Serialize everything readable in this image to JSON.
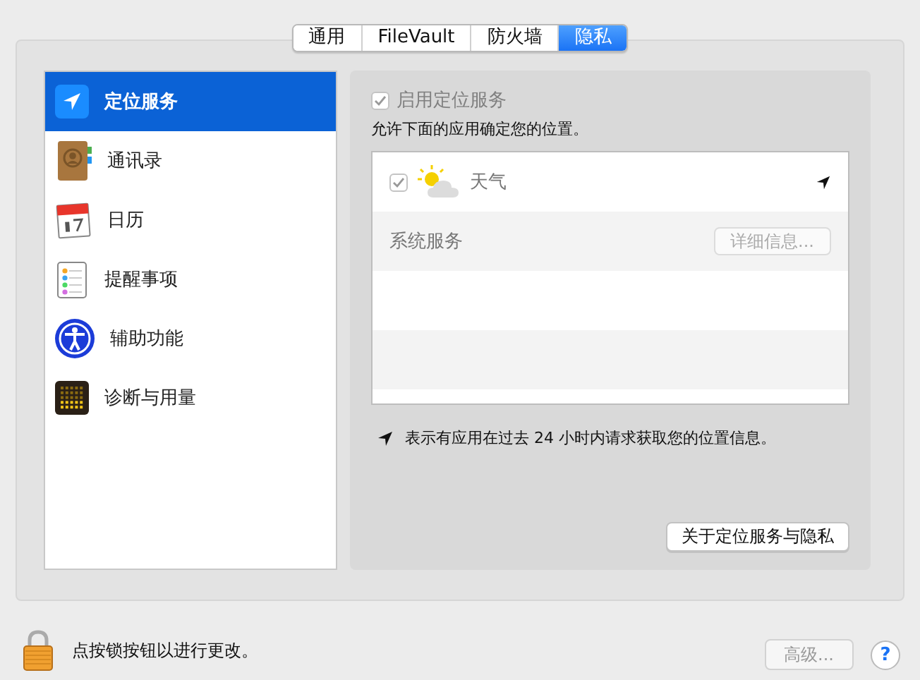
{
  "tabs": [
    {
      "label": "通用",
      "selected": false
    },
    {
      "label": "FileVault",
      "selected": false
    },
    {
      "label": "防火墙",
      "selected": false
    },
    {
      "label": "隐私",
      "selected": true
    }
  ],
  "sidebar": {
    "items": [
      {
        "label": "定位服务",
        "selected": true
      },
      {
        "label": "通讯录",
        "selected": false
      },
      {
        "label": "日历",
        "selected": false
      },
      {
        "label": "提醒事项",
        "selected": false
      },
      {
        "label": "辅助功能",
        "selected": false
      },
      {
        "label": "诊断与用量",
        "selected": false
      }
    ]
  },
  "location_services": {
    "label": "启用定位服务",
    "checked": true,
    "disabled": true
  },
  "description": "允许下面的应用确定您的位置。",
  "apps": [
    {
      "name": "天气",
      "checked": true,
      "disabled": true,
      "recent": true
    }
  ],
  "system_services": {
    "label": "系统服务",
    "button": {
      "label": "详细信息...",
      "disabled": true
    }
  },
  "legend": "表示有应用在过去 24 小时内请求获取您的位置信息。",
  "about_button": "关于定位服务与隐私",
  "footer": {
    "lock_text": "点按锁按钮以进行更改。",
    "advanced_button": {
      "label": "高级...",
      "disabled": true
    },
    "help": "?"
  }
}
